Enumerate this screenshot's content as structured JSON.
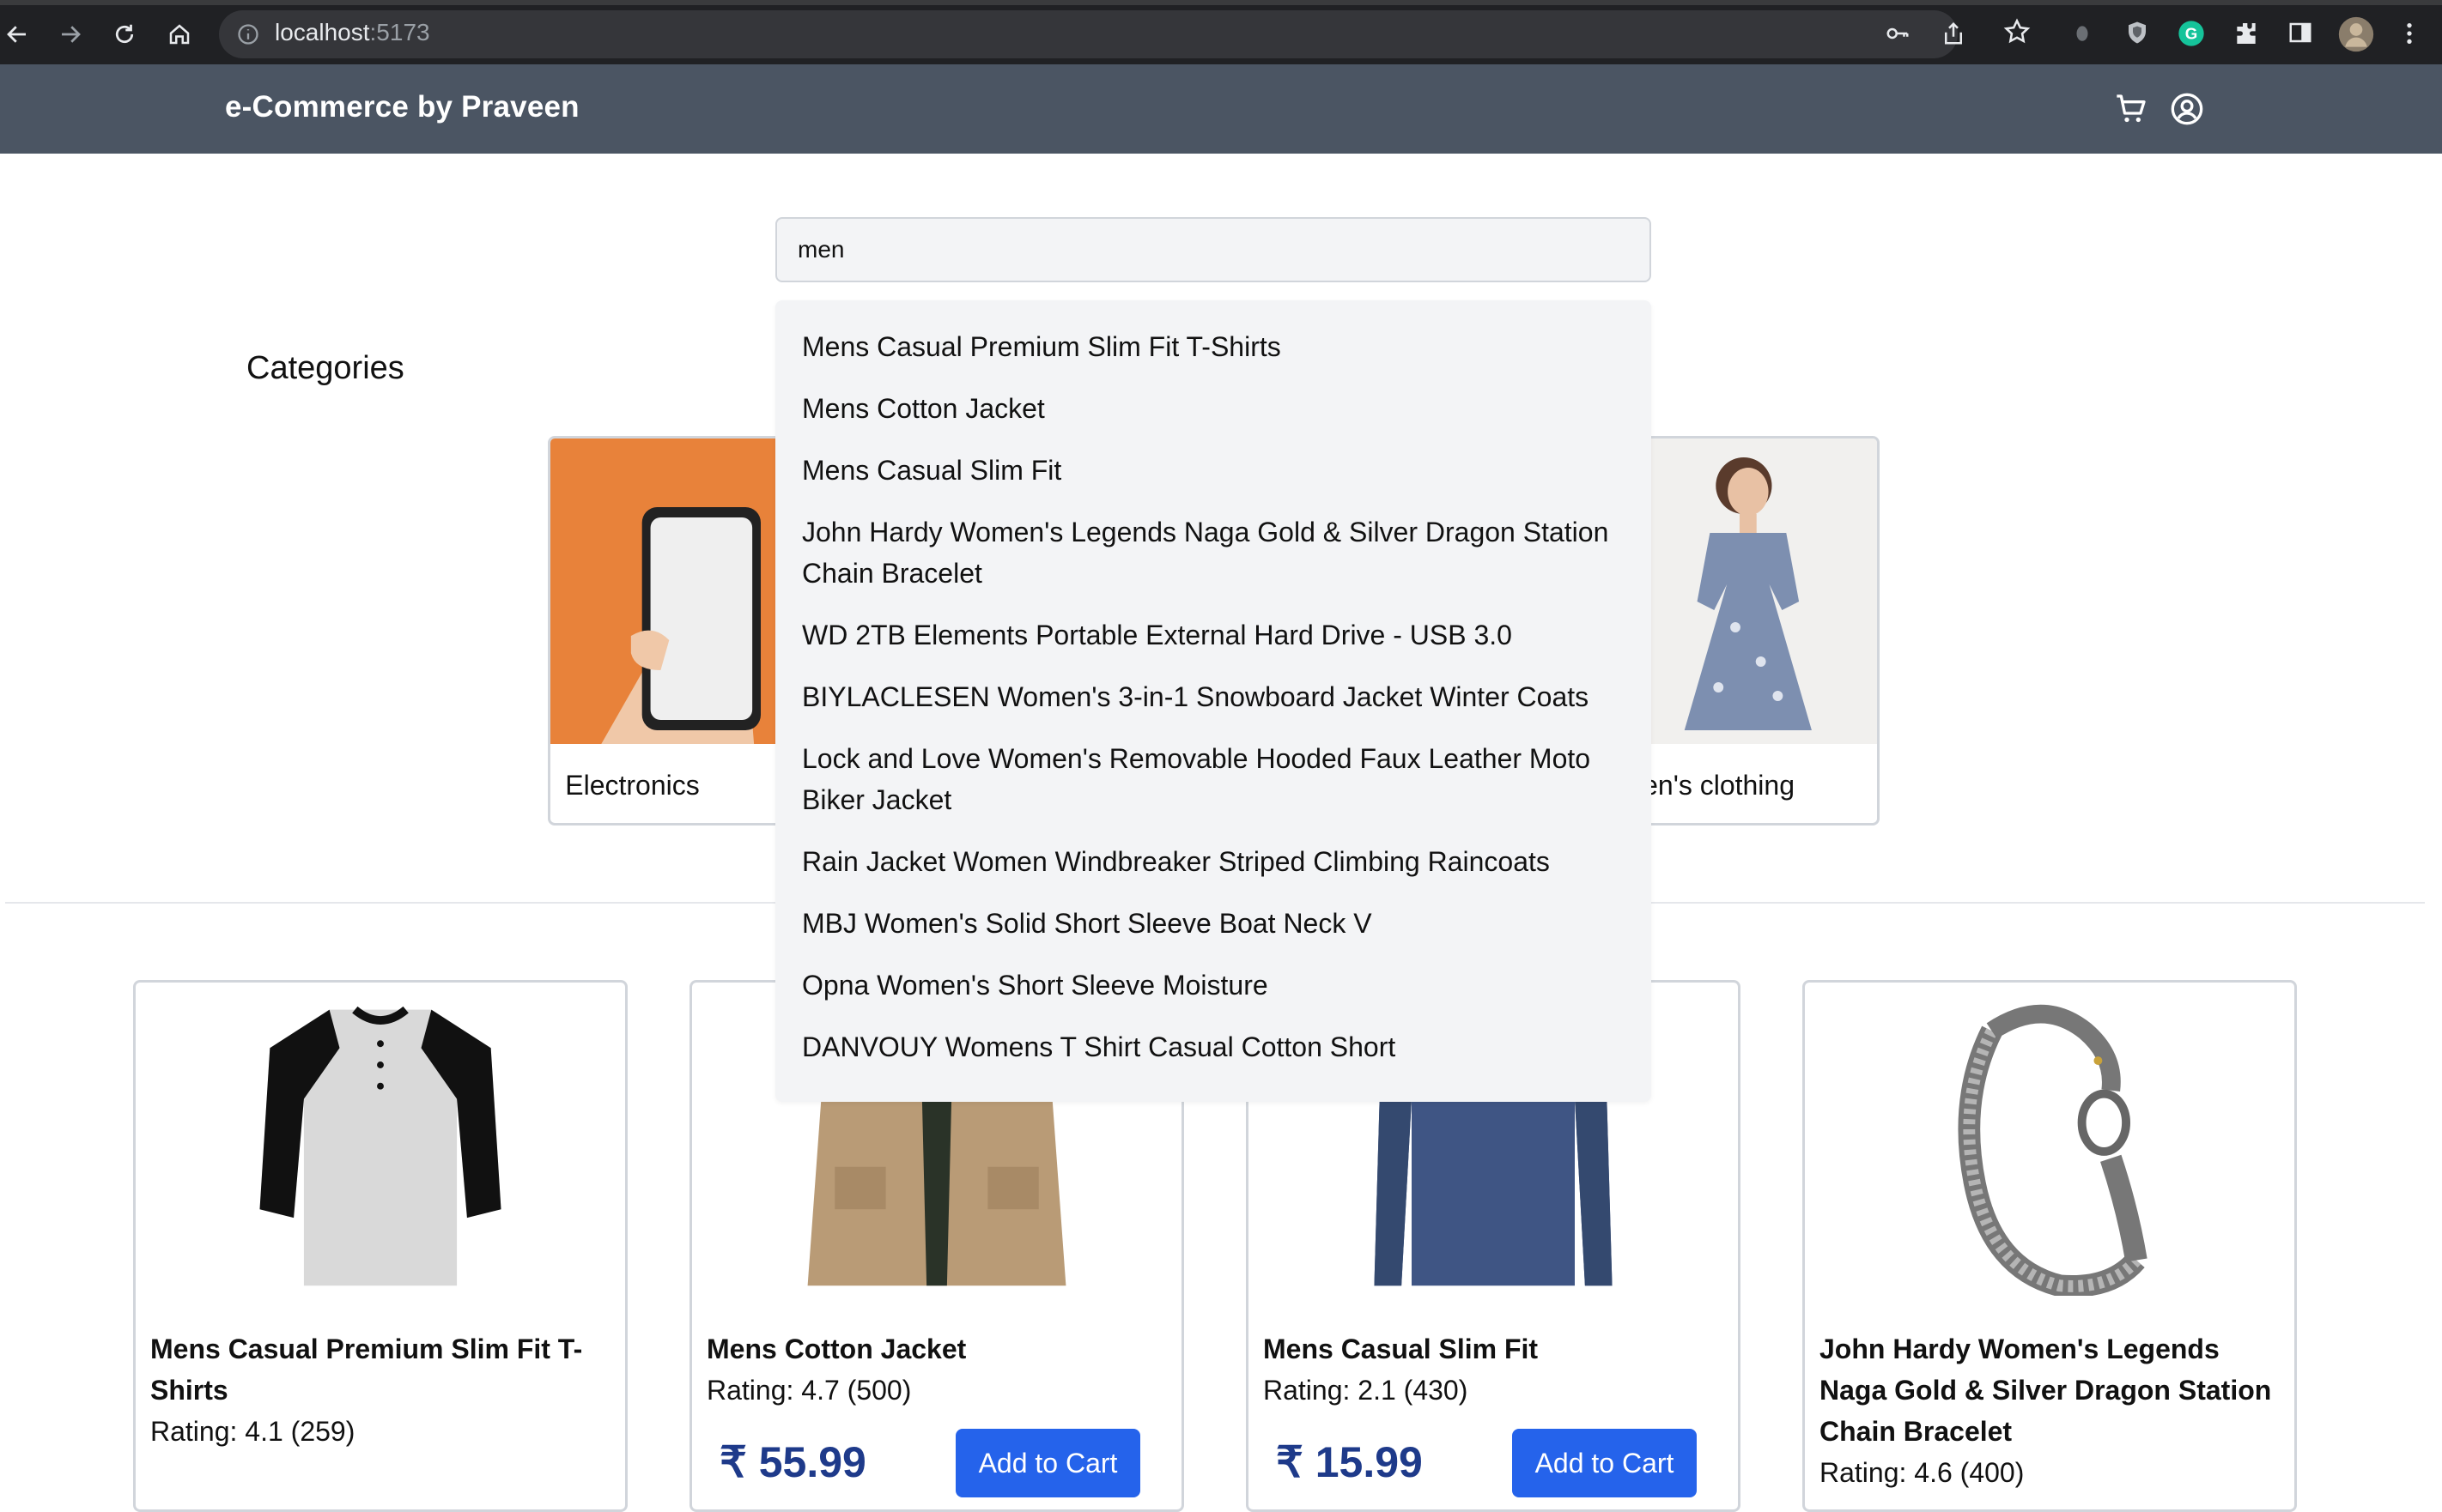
{
  "browser": {
    "url_host": "localhost",
    "url_port": ":5173"
  },
  "header": {
    "brand": "e-Commerce by Praveen"
  },
  "search": {
    "value": "men",
    "suggestions": [
      "Mens Casual Premium Slim Fit T-Shirts",
      "Mens Cotton Jacket",
      "Mens Casual Slim Fit",
      "John Hardy Women's Legends Naga Gold & Silver Dragon Station Chain Bracelet",
      "WD 2TB Elements Portable External Hard Drive - USB 3.0",
      "BIYLACLESEN Women's 3-in-1 Snowboard Jacket Winter Coats",
      "Lock and Love Women's Removable Hooded Faux Leather Moto Biker Jacket",
      "Rain Jacket Women Windbreaker Striped Climbing Raincoats",
      "MBJ Women's Solid Short Sleeve Boat Neck V",
      "Opna Women's Short Sleeve Moisture",
      "DANVOUY Womens T Shirt Casual Cotton Short"
    ]
  },
  "categories": {
    "title": "Categories",
    "items": [
      {
        "label": "Electronics"
      },
      {
        "label": "men's clothing"
      }
    ]
  },
  "products": [
    {
      "title": "Mens Casual Premium Slim Fit T-Shirts",
      "rating": "Rating: 4.1 (259)",
      "price": "",
      "button": ""
    },
    {
      "title": "Mens Cotton Jacket",
      "rating": "Rating: 4.7 (500)",
      "price": "₹ 55.99",
      "button": "Add to Cart"
    },
    {
      "title": "Mens Casual Slim Fit",
      "rating": "Rating: 2.1 (430)",
      "price": "₹ 15.99",
      "button": "Add to Cart"
    },
    {
      "title": "John Hardy Women's Legends Naga Gold & Silver Dragon Station Chain Bracelet",
      "rating": "Rating: 4.6 (400)",
      "price": "",
      "button": ""
    }
  ],
  "colors": {
    "appbar": "#4b5563",
    "accent": "#2563eb",
    "price": "#1e3a8a"
  }
}
